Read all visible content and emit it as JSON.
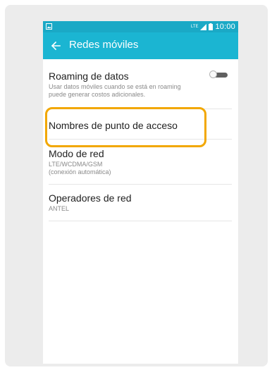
{
  "status_bar": {
    "network_label": "LTE",
    "time": "10:00"
  },
  "app_bar": {
    "title": "Redes móviles",
    "back_icon": "arrow-back-icon",
    "background": "#1bb5d2"
  },
  "settings": [
    {
      "title": "Roaming de datos",
      "subtitle": "Usar datos móviles cuando se está en roaming puede generar costos adicionales.",
      "toggle_on": false
    },
    {
      "title": "Nombres de punto de acceso",
      "subtitle": ""
    },
    {
      "title": "Modo de red",
      "subtitle_lines": [
        "LTE/WCDMA/GSM",
        "(conexión automática)"
      ]
    },
    {
      "title": "Operadores de red",
      "subtitle": "ANTEL"
    }
  ],
  "highlight_color": "#f2a700"
}
